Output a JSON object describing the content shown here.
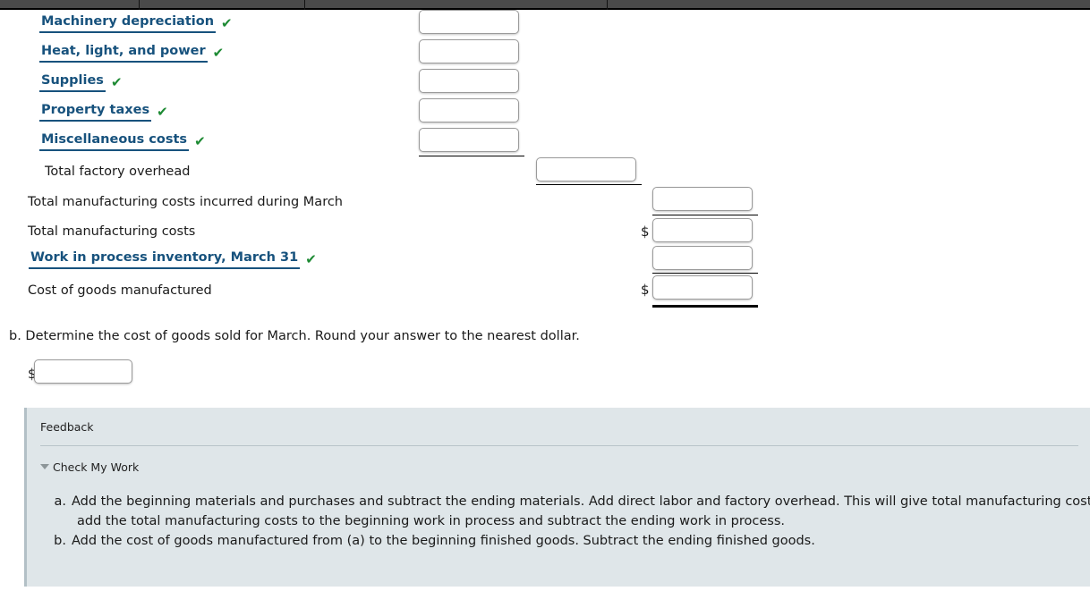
{
  "topbar": {
    "dividers": [
      155,
      340,
      678
    ]
  },
  "statement": {
    "rows": [
      {
        "label": "Machinery depreciation",
        "style": "link",
        "check": "✔"
      },
      {
        "label": "Heat, light, and power",
        "style": "link",
        "check": "✔"
      },
      {
        "label": "Supplies",
        "style": "link",
        "check": "✔"
      },
      {
        "label": "Property taxes",
        "style": "link",
        "check": "✔"
      },
      {
        "label": "Miscellaneous costs",
        "style": "link",
        "check": "✔"
      },
      {
        "label": "Total factory overhead",
        "style": "plain",
        "check": ""
      },
      {
        "label": "Total manufacturing costs incurred during March",
        "style": "plain",
        "check": ""
      },
      {
        "label": "Total manufacturing costs",
        "style": "plain",
        "check": ""
      },
      {
        "label": "Work in process inventory, March 31",
        "style": "link",
        "check": "✔"
      },
      {
        "label": "Cost of goods manufactured",
        "style": "plain",
        "check": ""
      }
    ],
    "inputs": {
      "machinery_depreciation": "",
      "heat_light_power": "",
      "supplies": "",
      "property_taxes": "",
      "miscellaneous_costs": "",
      "total_factory_overhead": "",
      "total_mfg_costs_incurred": "",
      "total_mfg_costs": "",
      "wip_march_31": "",
      "cost_of_goods_manufactured": ""
    },
    "currency_symbol": "$"
  },
  "part_b": {
    "prompt": "b. Determine the cost of goods sold for March. Round your answer to the nearest dollar.",
    "currency_symbol": "$",
    "answer": ""
  },
  "feedback": {
    "title": "Feedback",
    "check_my_work_label": "Check My Work",
    "items": [
      {
        "marker": "a.",
        "line1": "Add the beginning materials and purchases and subtract the ending materials. Add direct labor and factory overhead. This will give total manufacturing costs;",
        "line2": "add the total manufacturing costs to the beginning work in process and subtract the ending work in process."
      },
      {
        "marker": "b.",
        "line1": "Add the cost of goods manufactured from (a) to the beginning finished goods. Subtract the ending finished goods.",
        "line2": ""
      }
    ]
  },
  "colors": {
    "link": "#17527d",
    "check": "#1d8a33",
    "feedback_bg": "#dfe6e9",
    "topbar": "#4a4a4a"
  }
}
